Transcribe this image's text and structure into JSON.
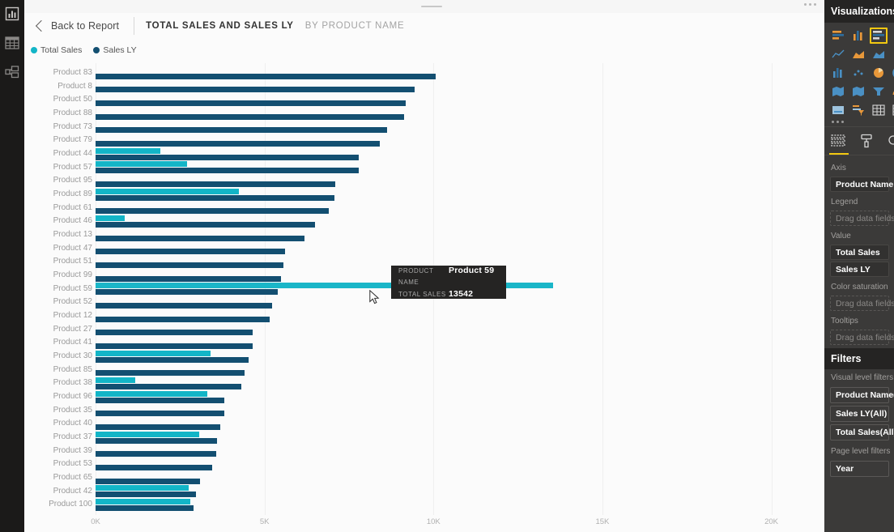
{
  "left_rail": {
    "items": [
      {
        "name": "report-view",
        "icon": "bar-chart-icon"
      },
      {
        "name": "data-view",
        "icon": "table-grid-icon"
      },
      {
        "name": "model-view",
        "icon": "relationships-icon"
      }
    ]
  },
  "header": {
    "back_label": "Back to Report",
    "title": "TOTAL SALES AND SALES LY",
    "subtitle": "BY PRODUCT NAME",
    "more_menu": "…"
  },
  "legend": {
    "items": [
      {
        "label": "Total Sales",
        "color": "#13b5c7"
      },
      {
        "label": "Sales LY",
        "color": "#134f71"
      }
    ]
  },
  "tooltip": {
    "rows": [
      {
        "key": "PRODUCT NAME",
        "value": "Product 59"
      },
      {
        "key": "TOTAL SALES",
        "value": "13542"
      }
    ]
  },
  "chart_data": {
    "type": "bar",
    "orientation": "horizontal",
    "title": "TOTAL SALES AND SALES LY",
    "subtitle": "BY PRODUCT NAME",
    "xlabel": "",
    "ylabel": "Product Name",
    "xlim": [
      0,
      22000
    ],
    "ticks": [
      "0K",
      "5K",
      "10K",
      "15K",
      "20K"
    ],
    "tick_values": [
      0,
      5000,
      10000,
      15000,
      20000
    ],
    "grid": true,
    "legend_position": "top-left",
    "categories": [
      "Product 83",
      "Product 8",
      "Product 50",
      "Product 88",
      "Product 73",
      "Product 79",
      "Product 44",
      "Product 57",
      "Product 95",
      "Product 89",
      "Product 61",
      "Product 46",
      "Product 13",
      "Product 47",
      "Product 51",
      "Product 99",
      "Product 59",
      "Product 52",
      "Product 12",
      "Product 27",
      "Product 41",
      "Product 30",
      "Product 85",
      "Product 38",
      "Product 96",
      "Product 35",
      "Product 40",
      "Product 37",
      "Product 39",
      "Product 53",
      "Product 65",
      "Product 42",
      "Product 100"
    ],
    "series": [
      {
        "name": "Total Sales",
        "color": "#13b5c7",
        "values": [
          0,
          0,
          0,
          0,
          0,
          0,
          1920,
          2720,
          0,
          4240,
          0,
          860,
          0,
          0,
          0,
          0,
          13542,
          0,
          0,
          0,
          0,
          3400,
          0,
          1180,
          3300,
          0,
          0,
          3060,
          0,
          0,
          0,
          2760,
          2800
        ]
      },
      {
        "name": "Sales LY",
        "color": "#134f71",
        "values": [
          10060,
          9450,
          9180,
          9120,
          8620,
          8400,
          7780,
          7780,
          7100,
          7080,
          6900,
          6500,
          6180,
          5600,
          5560,
          5480,
          5400,
          5220,
          5160,
          4660,
          4640,
          4520,
          4400,
          4320,
          3820,
          3800,
          3680,
          3600,
          3560,
          3440,
          3100,
          2980,
          2900
        ]
      }
    ],
    "highlighted": {
      "category": "Product 59",
      "series": "Total Sales",
      "value": 13542
    }
  },
  "visualizations_pane": {
    "title": "Visualizations",
    "selected_index": 2,
    "icon_count": 20,
    "overflow": "…",
    "tabs": [
      {
        "name": "fields-tab",
        "icon": "fields-icon",
        "active": true
      },
      {
        "name": "format-tab",
        "icon": "paint-roller-icon",
        "active": false
      },
      {
        "name": "analytics-tab",
        "icon": "magnifier-icon",
        "active": false
      }
    ],
    "wells": [
      {
        "label": "Axis",
        "fields": [
          "Product Name"
        ],
        "placeholder": null
      },
      {
        "label": "Legend",
        "fields": [],
        "placeholder": "Drag data fields here"
      },
      {
        "label": "Value",
        "fields": [
          "Total Sales",
          "Sales LY"
        ],
        "placeholder": null
      },
      {
        "label": "Color saturation",
        "fields": [],
        "placeholder": "Drag data fields here"
      },
      {
        "label": "Tooltips",
        "fields": [],
        "placeholder": "Drag data fields here"
      }
    ]
  },
  "filters_pane": {
    "title": "Filters",
    "visual_level_label": "Visual level filters",
    "visual_level_filters": [
      "Product Name(All)",
      "Sales LY(All)",
      "Total Sales(All)"
    ],
    "page_level_label": "Page level filters",
    "page_level_filters": [
      "Year"
    ]
  }
}
